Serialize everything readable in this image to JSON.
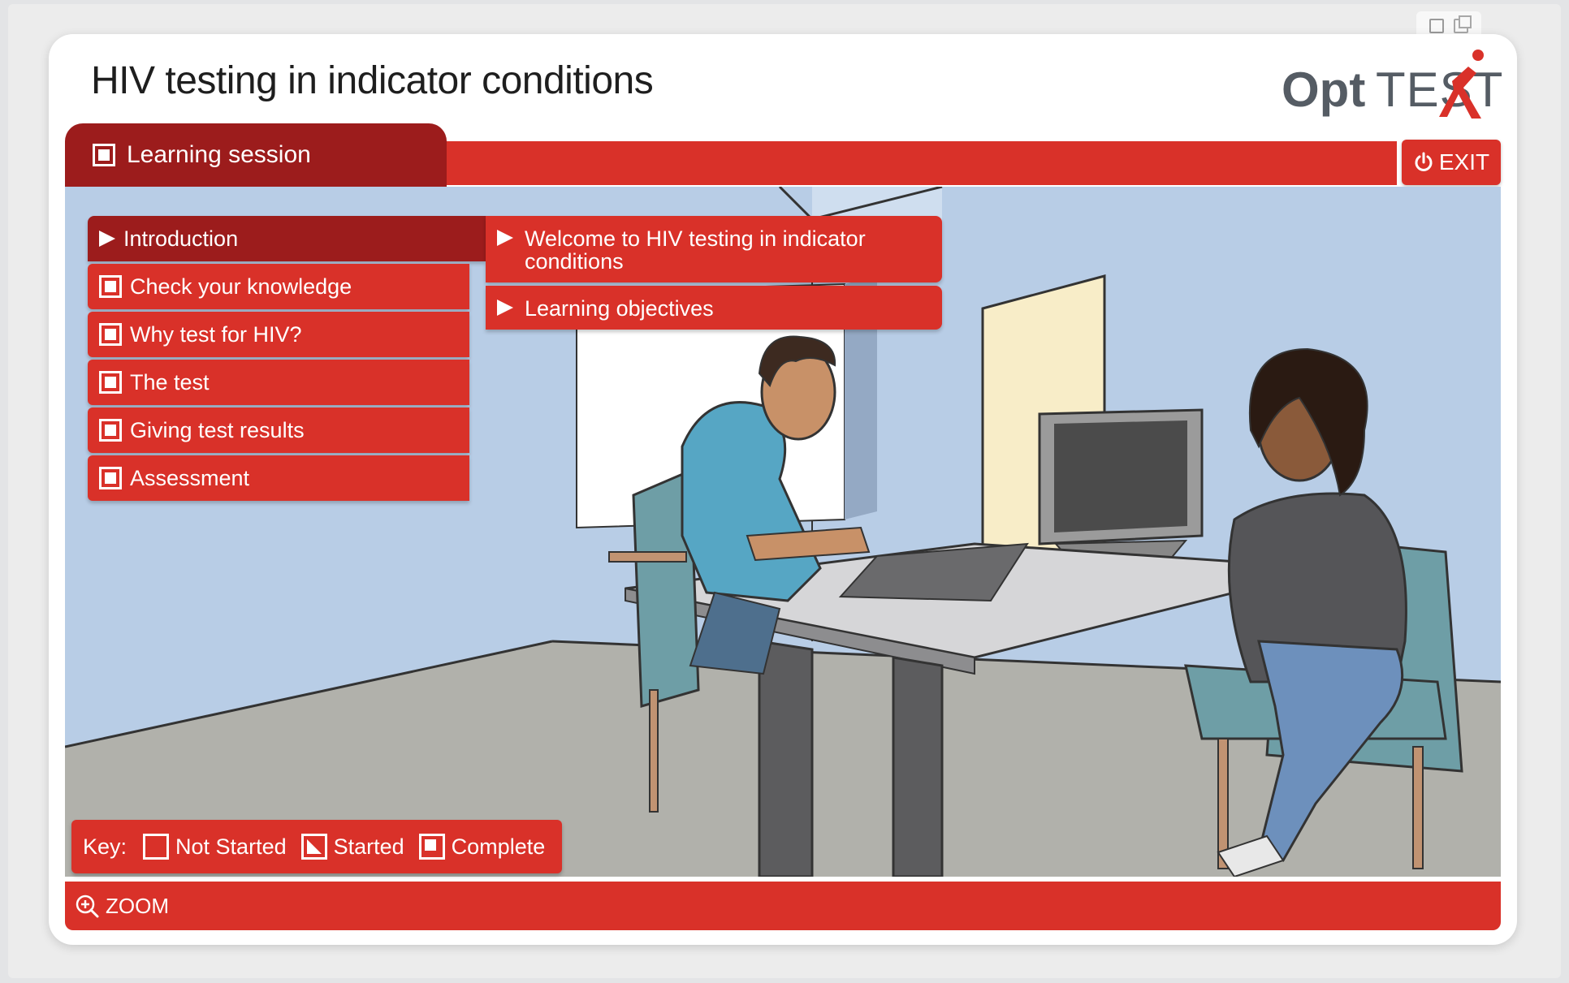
{
  "app": {
    "title": "HIV testing in indicator conditions",
    "logo_bold": "Opt",
    "logo_light": "TEST"
  },
  "header": {
    "session_label": "Learning session",
    "exit_label": "EXIT"
  },
  "menu": {
    "items": [
      {
        "label": "Introduction",
        "state": "active"
      },
      {
        "label": "Check your knowledge",
        "state": "complete"
      },
      {
        "label": "Why test for HIV?",
        "state": "complete"
      },
      {
        "label": "The test",
        "state": "complete"
      },
      {
        "label": "Giving test results",
        "state": "complete"
      },
      {
        "label": "Assessment",
        "state": "complete"
      }
    ],
    "submenu": [
      {
        "label": "Welcome to HIV testing in indicator conditions"
      },
      {
        "label": "Learning objectives"
      }
    ]
  },
  "key": {
    "label": "Key:",
    "not_started": "Not Started",
    "started": "Started",
    "complete": "Complete"
  },
  "footer": {
    "zoom_label": "ZOOM"
  },
  "colors": {
    "primary_red": "#d93129",
    "dark_red": "#9c1c1c",
    "logo_grey": "#555c64",
    "wall_blue": "#b8cde6"
  }
}
